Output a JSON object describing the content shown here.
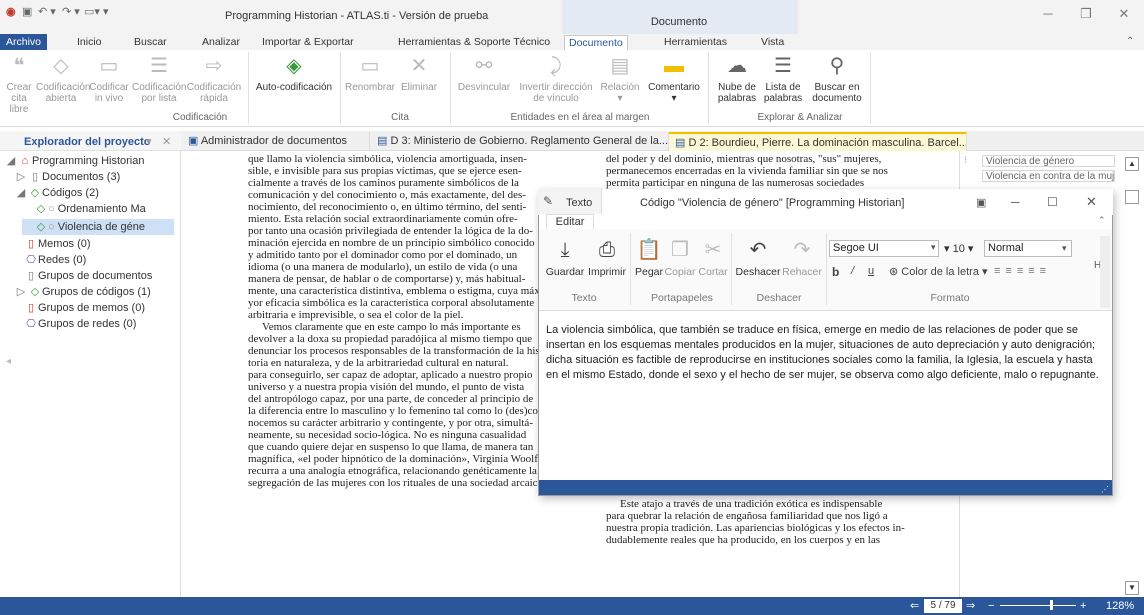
{
  "app": {
    "title": "Programming Historian - ATLAS.ti - Versión de prueba",
    "context_tab_group": "Documento"
  },
  "ribbon_tabs": [
    "Archivo",
    "Inicio",
    "Buscar",
    "Analizar",
    "Importar & Exportar",
    "Herramientas & Soporte Técnico",
    "Documento",
    "Herramientas",
    "Vista"
  ],
  "ribbon": {
    "buttons": {
      "crear_cita": "Crear cita\nlibre",
      "cod_abierta": "Codificación\nabierta",
      "cod_vivo": "Codificar\nin vivo",
      "cod_lista": "Codificación\npor lista",
      "cod_rapida": "Codificación\nrápida",
      "auto_cod": "Auto-codificación",
      "renombrar": "Renombrar",
      "eliminar": "Eliminar",
      "desvincular": "Desvincular",
      "invertir": "Invertir dirección\nde vínculo",
      "relacion": "Relación",
      "comentario": "Comentario",
      "nube": "Nube de\npalabras",
      "lista": "Lista de\npalabras",
      "buscar_doc": "Buscar en\ndocumento"
    },
    "groups": {
      "codificacion": "Codificación",
      "cita": "Cita",
      "entidades": "Entidades en el área al margen",
      "explorar": "Explorar & Analizar"
    }
  },
  "left_panel": {
    "title": "Explorador del proyecto",
    "tree": [
      "Programming Historian",
      "Documentos (3)",
      "Códigos (2)",
      "Ordenamiento Ma",
      "Violencia de géne",
      "Memos (0)",
      "Redes (0)",
      "Grupos de documentos",
      "Grupos de códigos (1)",
      "Grupos de memos (0)",
      "Grupos de redes (0)"
    ]
  },
  "doc_tabs": [
    "Administrador de documentos",
    "D 3: Ministerio de Gobierno. Reglamento General de la...",
    "D 2: Bourdieu, Pierre. La dominación masculina. Barcel..."
  ],
  "document": {
    "left_col": [
      "que llamo la violencia simbólica, violencia amortiguada, insen-",
      "sible, e invisible para sus propias víctimas, que se ejerce esen-",
      "cialmente a través de los caminos puramente simbólicos de la",
      "comunicación y del conocimiento o, más exactamente, del des-",
      "nocimiento, del reconocimiento o, en último término, del senti-",
      "miento. Esta relación social extraordinariamente común ofre-",
      "por tanto una ocasión privilegiada de entender la lógica de la do-",
      "minación ejercida en nombre de un principio simbólico conocido",
      "y admitido tanto por el dominador como por el dominado, un",
      "idioma (o una manera de modularlo), un estilo de vida (o una",
      "manera de pensar, de hablar o de comportarse) y, más habitual-",
      "mente, una característica distintiva, emblema o estigma, cuya máxima",
      "yor eficacia simbólica es la característica corporal absolutamente",
      "arbitraria e imprevisible, o sea el color de la piel.",
      "Vemos claramente que en este campo lo más importante es",
      "devolver a la doxa su propiedad paradójica al mismo tiempo que",
      "denunciar los procesos responsables de la transformación de la his-",
      "toria en naturaleza, y de la arbitrariedad cultural en natural.",
      "para conseguirlo, ser capaz de adoptar, aplicado a nuestro propio",
      "universo y a nuestra propia visión del mundo, el punto de vista",
      "del antropólogo capaz, por una parte, de conceder al principio de",
      "la diferencia entre lo masculino y lo femenino tal como lo (des)co-",
      "nocemos su carácter arbitrario y contingente, y por otra, simultá-",
      "neamente, su necesidad socio-lógica. No es ninguna casualidad",
      "que cuando quiere dejar en suspenso lo que llama, de manera tan",
      "magnífica, «el poder hipnótico de la dominación», Virginia Woolf",
      "recurra a una analogía etnográfica, relacionando genéticamente la",
      "segregación de las mujeres con los rituales de una sociedad arcaica:"
    ],
    "right_col_top": [
      "del poder y del dominio, mientras que nosotras, \"sus\" mujeres,",
      "permanecemos encerradas en la vivienda familiar sin que se nos",
      "permita participar en ninguna de las numerosas sociedades"
    ],
    "right_col_bottom": [
      "Este atajo a través de una tradición exótica es indispensable",
      "para quebrar la relación de engañosa familiaridad que nos ligó a",
      "nuestra propia tradición. Las apariencias biológicas y los efectos in-",
      "dudablemente reales que ha producido, en los cuerpos y en las"
    ]
  },
  "right_panel": {
    "codes": [
      "Violencia de género",
      "Violencia en contra de la mujer"
    ]
  },
  "popup": {
    "tab": "Texto",
    "subtab": "Editar",
    "title": "Código \"Violencia de género\" [Programming Historian]",
    "buttons": {
      "guardar": "Guardar",
      "imprimir": "Imprimir",
      "pegar": "Pegar",
      "copiar": "Copiar",
      "cortar": "Cortar",
      "deshacer": "Deshacer",
      "rehacer": "Rehacer",
      "color": "Color de la letra"
    },
    "groups": {
      "texto": "Texto",
      "portapapeles": "Portapapeles",
      "deshacer": "Deshacer",
      "formato": "Formato"
    },
    "font": "Segoe UI",
    "size": "10",
    "style": "Normal",
    "body": "La violencia simbólica, que también se traduce en física, emerge en medio de las relaciones de poder que se insertan en los esquemas mentales producidos en la mujer, situaciones de auto depreciación y auto denigración; dicha situación es factible de reproducirse en instituciones sociales como la familia, la Iglesia, la escuela y hasta en el mismo Estado, donde el sexo y el hecho de ser mujer, se observa como algo deficiente, malo o repugnante."
  },
  "status": {
    "page": "5 / 79",
    "zoom": "128%"
  },
  "colors": {
    "accent": "#2b579a",
    "selection": "#cde0f5",
    "active_tab": "#f0c000"
  }
}
